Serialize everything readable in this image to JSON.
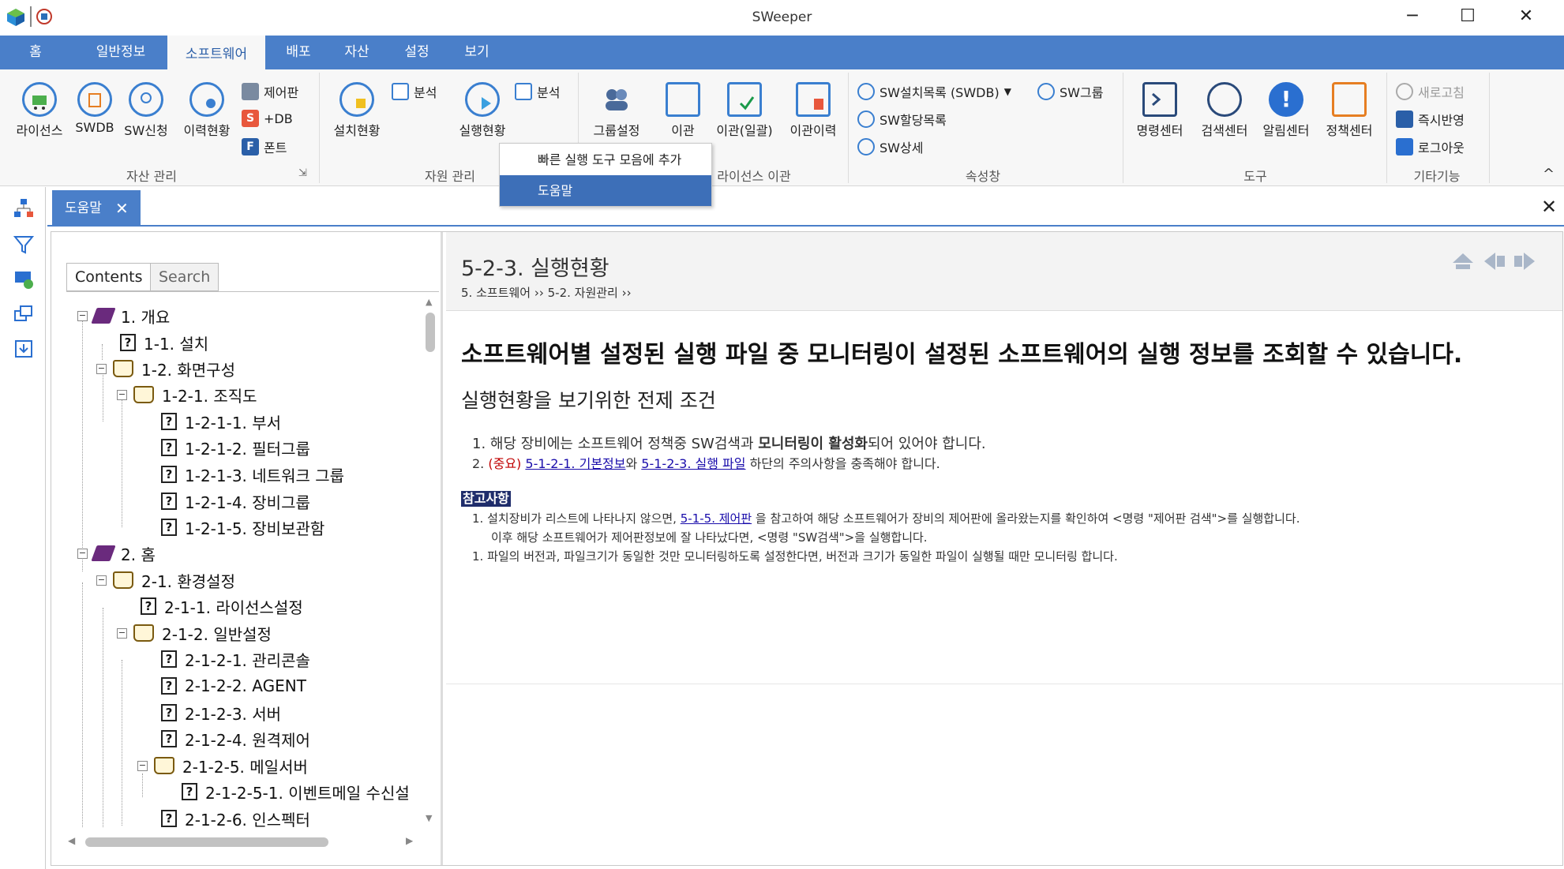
{
  "app": {
    "title": "SWeeper"
  },
  "window": {
    "minimize": "─",
    "maximize": "☐",
    "close": "✕"
  },
  "ribbon_tabs": [
    {
      "label": "홈"
    },
    {
      "label": "일반정보"
    },
    {
      "label": "소프트웨어",
      "active": true
    },
    {
      "label": "배포"
    },
    {
      "label": "자산"
    },
    {
      "label": "설정"
    },
    {
      "label": "보기"
    }
  ],
  "ribbon": {
    "asset_group": {
      "label": "자산 관리",
      "buttons": [
        "라이선스",
        "SWDB",
        "SW신청",
        "이력현황"
      ],
      "small": [
        "제어판",
        "+DB",
        "폰트"
      ]
    },
    "resource_group": {
      "label": "자원 관리",
      "buttons": [
        "설치현황",
        "실행현황"
      ],
      "small": [
        "분석",
        "분석"
      ]
    },
    "license_group": {
      "label": "라이선스 이관",
      "buttons": [
        "그룹설정",
        "이관",
        "이관(일괄)",
        "이관이력"
      ]
    },
    "property_group": {
      "label": "속성창",
      "small": [
        "SW설치목록 (SWDB)",
        "SW그룹",
        "SW할당목록",
        "SW상세"
      ]
    },
    "tools_group": {
      "label": "도구",
      "buttons": [
        "명령센터",
        "검색센터",
        "알림센터",
        "정책센터"
      ]
    },
    "etc_group": {
      "label": "기타기능",
      "small": [
        "새로고침",
        "즉시반영",
        "로그아웃"
      ]
    },
    "collapse": "^"
  },
  "context_menu": {
    "items": [
      "빠른 실행 도구 모음에 추가",
      "도움말"
    ],
    "selected": "도움말"
  },
  "doc_tab": {
    "label": "도움말",
    "close": "✕"
  },
  "panel_close": "✕",
  "help": {
    "tabs": [
      "Contents",
      "Search"
    ],
    "tree": [
      {
        "label": "1. 개요",
        "type": "book-closed",
        "level": 0
      },
      {
        "label": "1-1. 설치",
        "type": "page",
        "level": 1
      },
      {
        "label": "1-2. 화면구성",
        "type": "book-open",
        "level": 1
      },
      {
        "label": "1-2-1. 조직도",
        "type": "book-open",
        "level": 2
      },
      {
        "label": "1-2-1-1. 부서",
        "type": "page",
        "level": 3
      },
      {
        "label": "1-2-1-2. 필터그룹",
        "type": "page",
        "level": 3
      },
      {
        "label": "1-2-1-3. 네트워크 그룹",
        "type": "page",
        "level": 3
      },
      {
        "label": "1-2-1-4. 장비그룹",
        "type": "page",
        "level": 3
      },
      {
        "label": "1-2-1-5. 장비보관함",
        "type": "page",
        "level": 3
      },
      {
        "label": "2. 홈",
        "type": "book-closed",
        "level": 0
      },
      {
        "label": "2-1. 환경설정",
        "type": "book-open",
        "level": 1
      },
      {
        "label": "2-1-1. 라이선스설정",
        "type": "page",
        "level": 2
      },
      {
        "label": "2-1-2. 일반설정",
        "type": "book-open",
        "level": 2
      },
      {
        "label": "2-1-2-1. 관리콘솔",
        "type": "page",
        "level": 3
      },
      {
        "label": "2-1-2-2. AGENT",
        "type": "page",
        "level": 3
      },
      {
        "label": "2-1-2-3. 서버",
        "type": "page",
        "level": 3
      },
      {
        "label": "2-1-2-4. 원격제어",
        "type": "page",
        "level": 3
      },
      {
        "label": "2-1-2-5. 메일서버",
        "type": "book-open",
        "level": 3
      },
      {
        "label": "2-1-2-5-1. 이벤트메일 수신설",
        "type": "page",
        "level": 4
      },
      {
        "label": "2-1-2-6. 인스펙터",
        "type": "page",
        "level": 3
      }
    ],
    "page": {
      "title": "5-2-3. 실행현황",
      "breadcrumb": "5. 소프트웨어 ›› 5-2. 자원관리 ››",
      "lead": "소프트웨어별 설정된 실행 파일 중 모니터링이 설정된 소프트웨어의 실행 정보를 조회할 수 있습니다.",
      "subheading": "실행현황을 보기위한 전제 조건",
      "cond1_a": "1. 해당 장비에는 소프트웨어 정책중 SW검색과 ",
      "cond1_b": "모니터링이 활성화",
      "cond1_c": "되어 있어야 합니다.",
      "cond2_num": "2. ",
      "cond2_warn": "(중요)",
      "cond2_link1": "5-1-2-1. 기본정보",
      "cond2_mid": "와 ",
      "cond2_link2": "5-1-2-3. 실행 파일",
      "cond2_end": " 하단의 주의사항을 충족해야 합니다.",
      "note_tag": "참고사항",
      "note1_a": "1. 설치장비가 리스트에 나타나지 않으면, ",
      "note1_link": "5-1-5. 제어판",
      "note1_b": " 을 참고하여 해당 소프트웨어가 장비의 제어판에 올라왔는지를 확인하여 <명령 \"제어판 검색\">를 실행합니다.",
      "note1_c": "이후 해당 소프트웨어가 제어판정보에 잘 나타났다면, <명령 \"SW검색\">을 실행합니다.",
      "note2": "1. 파일의 버전과, 파일크기가 동일한 것만 모니터링하도록 설정한다면, 버전과 크기가 동일한 파일이 실행될 때만 모니터링 합니다."
    }
  },
  "colors": {
    "accent": "#4a7fc9",
    "menu_selected": "#3d6fb8",
    "note_tag": "#1f2d6b",
    "warning": "#c00000"
  }
}
